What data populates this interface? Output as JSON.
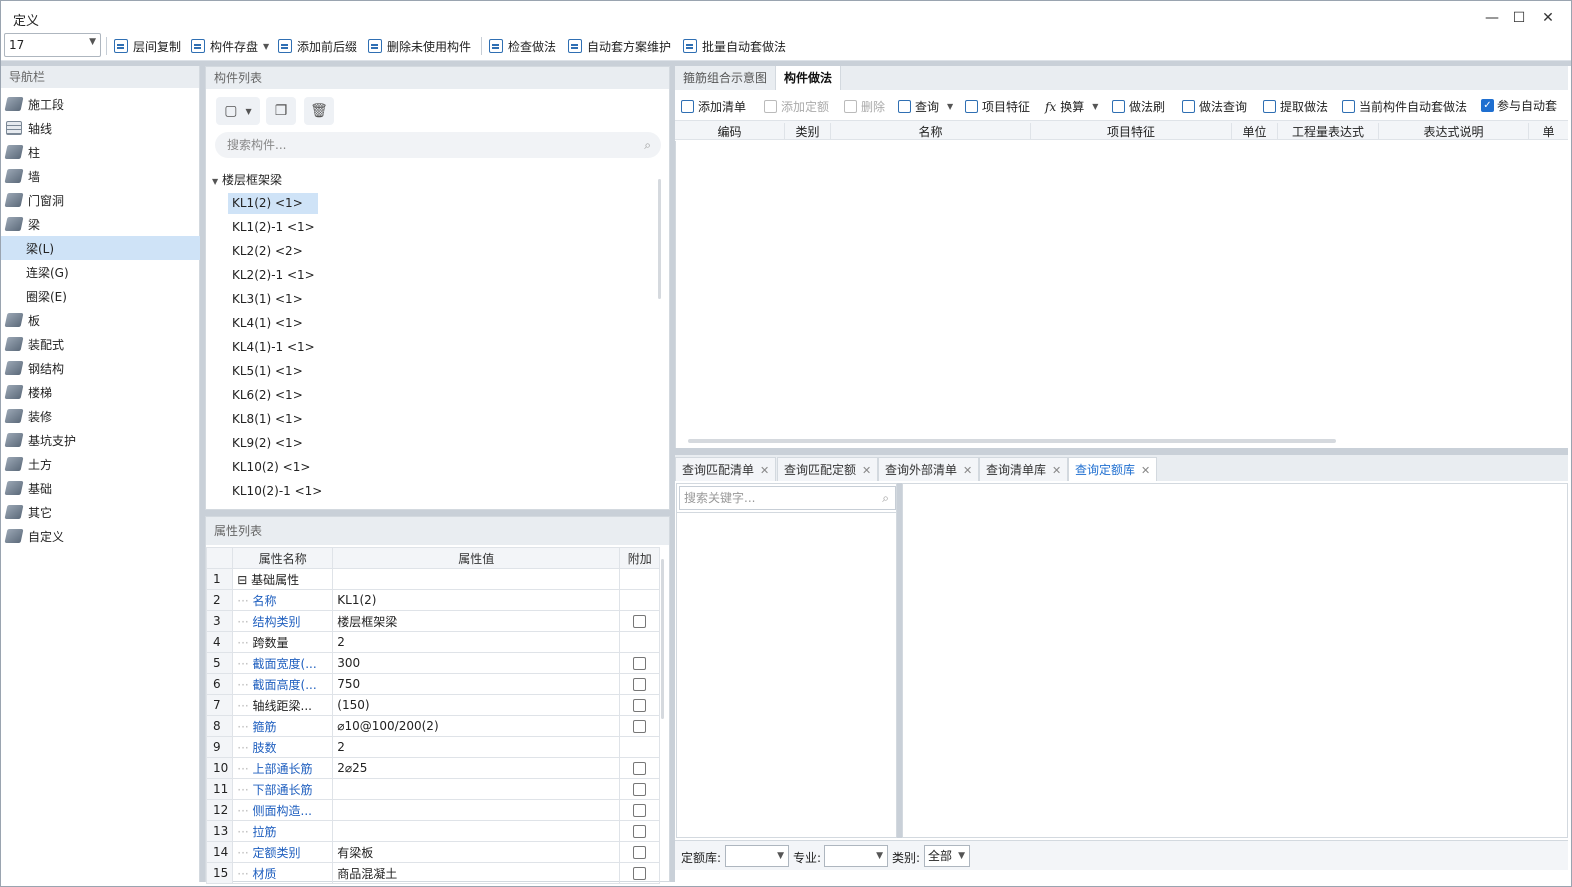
{
  "window": {
    "title": "定义",
    "min": "—",
    "max": "☐",
    "close": "✕"
  },
  "toolbar": {
    "floor_value": "17",
    "items": [
      "层间复制",
      "构件存盘",
      "添加前后缀",
      "删除未使用构件",
      "检查做法",
      "自动套方案维护",
      "批量自动套做法"
    ]
  },
  "nav": {
    "header": "导航栏",
    "items": [
      {
        "label": "施工段"
      },
      {
        "label": "轴线"
      },
      {
        "label": "柱"
      },
      {
        "label": "墙"
      },
      {
        "label": "门窗洞"
      },
      {
        "label": "梁"
      },
      {
        "label": "梁(L)"
      },
      {
        "label": "连梁(G)"
      },
      {
        "label": "圈梁(E)"
      },
      {
        "label": "板"
      },
      {
        "label": "装配式"
      },
      {
        "label": "钢结构"
      },
      {
        "label": "楼梯"
      },
      {
        "label": "装修"
      },
      {
        "label": "基坑支护"
      },
      {
        "label": "土方"
      },
      {
        "label": "基础"
      },
      {
        "label": "其它"
      },
      {
        "label": "自定义"
      }
    ]
  },
  "component_list": {
    "header": "构件列表",
    "search_placeholder": "搜索构件...",
    "root": "楼层框架梁",
    "items": [
      "KL1(2) <1>",
      "KL1(2)-1 <1>",
      "KL2(2) <2>",
      "KL2(2)-1 <1>",
      "KL3(1) <1>",
      "KL4(1) <1>",
      "KL4(1)-1 <1>",
      "KL5(1) <1>",
      "KL6(2) <1>",
      "KL8(1) <1>",
      "KL9(2) <1>",
      "KL10(2) <1>",
      "KL10(2)-1 <1>"
    ]
  },
  "properties": {
    "header": "属性列表",
    "columns": [
      "属性名称",
      "属性值",
      "附加"
    ],
    "rows": [
      {
        "n": "1",
        "name": "基础属性",
        "value": ""
      },
      {
        "n": "2",
        "name": "名称",
        "value": "KL1(2)"
      },
      {
        "n": "3",
        "name": "结构类别",
        "value": "楼层框架梁"
      },
      {
        "n": "4",
        "name": "跨数量",
        "value": "2"
      },
      {
        "n": "5",
        "name": "截面宽度(...",
        "value": "300"
      },
      {
        "n": "6",
        "name": "截面高度(...",
        "value": "750"
      },
      {
        "n": "7",
        "name": "轴线距梁...",
        "value": "(150)"
      },
      {
        "n": "8",
        "name": "箍筋",
        "value": "⌀10@100/200(2)"
      },
      {
        "n": "9",
        "name": "肢数",
        "value": "2"
      },
      {
        "n": "10",
        "name": "上部通长筋",
        "value": "2⌀25"
      },
      {
        "n": "11",
        "name": "下部通长筋",
        "value": ""
      },
      {
        "n": "12",
        "name": "侧面构造...",
        "value": ""
      },
      {
        "n": "13",
        "name": "拉筋",
        "value": ""
      },
      {
        "n": "14",
        "name": "定额类别",
        "value": "有梁板"
      },
      {
        "n": "15",
        "name": "材质",
        "value": "商品混凝土"
      }
    ]
  },
  "right_tabs": [
    "箍筋组合示意图",
    "构件做法"
  ],
  "method_toolbar": [
    "添加清单",
    "添加定额",
    "删除",
    "查询",
    "项目特征",
    "换算",
    "做法刷",
    "做法查询",
    "提取做法",
    "当前构件自动套做法",
    "参与自动套"
  ],
  "method_grid_columns": [
    "编码",
    "类别",
    "名称",
    "项目特征",
    "单位",
    "工程量表达式",
    "表达式说明",
    "单"
  ],
  "bottom_tabs": [
    "查询匹配清单",
    "查询匹配定额",
    "查询外部清单",
    "查询清单库",
    "查询定额库"
  ],
  "bottom_search_placeholder": "搜索关键字...",
  "bottom_bar": {
    "quota_label": "定额库:",
    "major_label": "专业:",
    "type_label": "类别:",
    "type_value": "全部"
  }
}
